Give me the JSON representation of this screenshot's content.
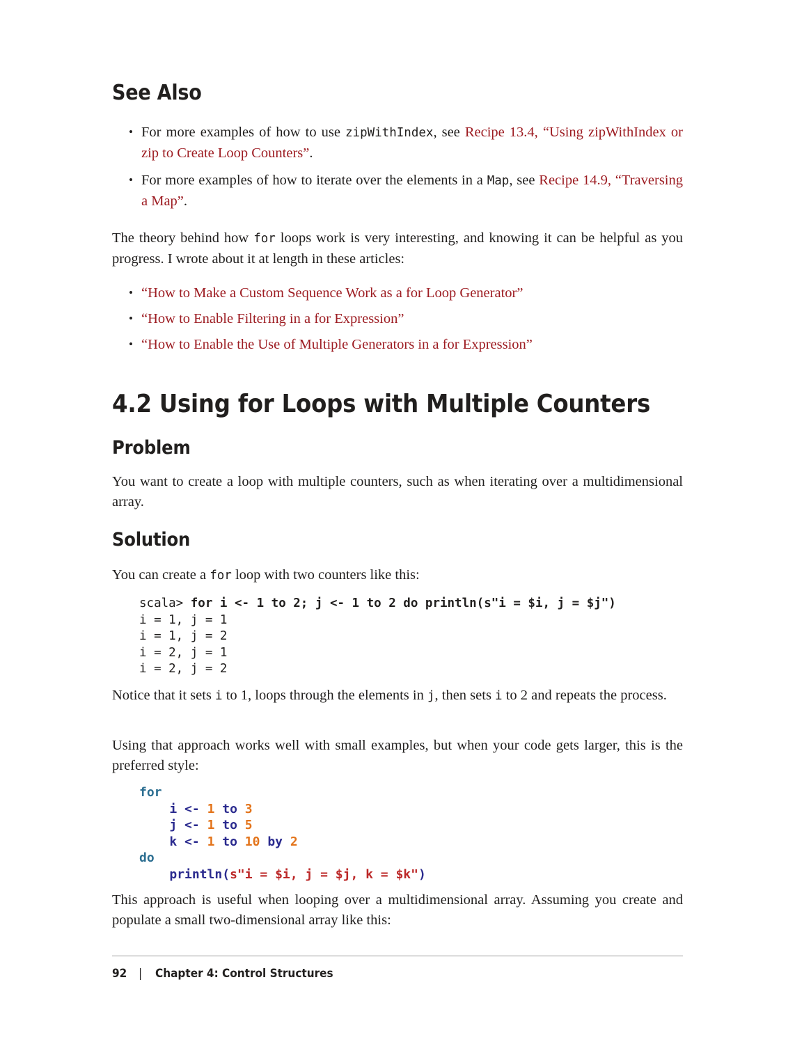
{
  "page": {
    "number": "92",
    "footer_separator": "|",
    "footer_chapter": "Chapter 4: Control Structures"
  },
  "see_also": {
    "heading": "See Also",
    "items": [
      {
        "prefix": "For more examples of how to use ",
        "code": "zipWithIndex",
        "middle": ", see ",
        "xref": "Recipe 13.4, “Using zipWithIndex or zip to Create Loop Counters”",
        "suffix": "."
      },
      {
        "prefix": "For more examples of how to iterate over the elements in a ",
        "code": "Map",
        "middle": ", see ",
        "xref": "Recipe 14.9, “Traversing a Map”",
        "suffix": "."
      }
    ],
    "theory_paragraph": {
      "part1": "The theory behind how ",
      "code": "for",
      "part2": " loops work is very interesting, and knowing it can be helpful as you progress. I wrote about it at length in these articles:"
    },
    "articles": [
      "“How to Make a Custom Sequence Work as a for Loop Generator”",
      "“How to Enable Filtering in a for Expression”",
      "“How to Enable the Use of Multiple Generators in a for Expression”"
    ]
  },
  "recipe": {
    "heading": "4.2 Using for Loops with Multiple Counters",
    "problem": {
      "heading": "Problem",
      "text": "You want to create a loop with multiple counters, such as when iterating over a multidimensional array."
    },
    "solution": {
      "heading": "Solution",
      "intro": {
        "part1": "You can create a ",
        "code": "for",
        "part2": " loop with two counters like this:"
      },
      "repl": {
        "prompt": "scala> ",
        "command": "for i <- 1 to 2; j <- 1 to 2 do println(s\"i = $i, j = $j\")",
        "output": [
          "i = 1, j = 1",
          "i = 1, j = 2",
          "i = 2, j = 1",
          "i = 2, j = 2"
        ]
      },
      "notice": {
        "part1": "Notice that it sets ",
        "c1": "i",
        "part2": " to 1, loops through the elements in ",
        "c2": "j",
        "part3": ", then sets ",
        "c3": "i",
        "part4": " to 2 and repeats the process."
      },
      "preferred": "Using that approach works well with small examples, but when your code gets larger, this is the preferred style:",
      "syntax_block": {
        "line1_kw": "for",
        "line2": {
          "var": "i",
          "arrow": "<-",
          "from": "1",
          "to": "to",
          "upper": "3"
        },
        "line3": {
          "var": "j",
          "arrow": "<-",
          "from": "1",
          "to": "to",
          "upper": "5"
        },
        "line4": {
          "var": "k",
          "arrow": "<-",
          "from": "1",
          "to": "to",
          "upper": "10",
          "by": "by",
          "step": "2"
        },
        "line5_kw": "do",
        "line6": {
          "fn": "println",
          "open": "(",
          "string": "s\"i = $i, j = $j, k = $k\"",
          "close": ")"
        }
      },
      "closing": "This approach is useful when looping over a multidimensional array. Assuming you create and populate a small two-dimensional array like this:"
    }
  },
  "colors": {
    "text": "#211f1e",
    "link_red": "#9d1c22",
    "keyword_teal": "#2c6e91",
    "identifier_navy": "#2b2b8f",
    "number_orange": "#e3741b",
    "string_red": "#bc2828",
    "rule_gray": "#9a9a9a"
  }
}
